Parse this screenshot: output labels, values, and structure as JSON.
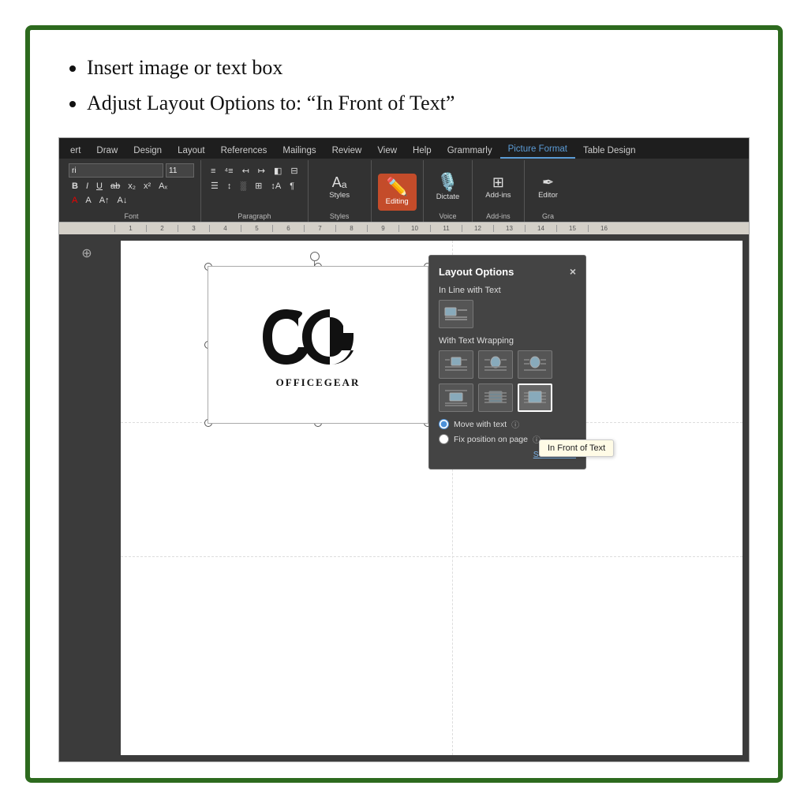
{
  "border_color": "#2d6a1e",
  "instructions": {
    "bullet1": "Insert image or text box",
    "bullet2": "Adjust Layout Options to: “In Front of Text”"
  },
  "ribbon": {
    "tabs": [
      {
        "label": "ert",
        "active": false
      },
      {
        "label": "Draw",
        "active": false
      },
      {
        "label": "Design",
        "active": false
      },
      {
        "label": "Layout",
        "active": false
      },
      {
        "label": "References",
        "active": false
      },
      {
        "label": "Mailings",
        "active": false
      },
      {
        "label": "Review",
        "active": false
      },
      {
        "label": "View",
        "active": false
      },
      {
        "label": "Help",
        "active": false
      },
      {
        "label": "Grammarly",
        "active": false
      },
      {
        "label": "Picture Format",
        "active": true
      },
      {
        "label": "Table Design",
        "active": false
      }
    ],
    "font_name": "ri",
    "font_size": "11",
    "groups": [
      {
        "label": "Font"
      },
      {
        "label": "Paragraph"
      },
      {
        "label": "Styles"
      },
      {
        "label": "Voice"
      },
      {
        "label": "Add-ins"
      },
      {
        "label": "Gra"
      }
    ],
    "buttons": {
      "styles": "Styles",
      "editing": "Editing",
      "dictate": "Dictate",
      "add_ins": "Add-ins",
      "editor": "Editor"
    }
  },
  "logo": {
    "text": "OfficeGear"
  },
  "layout_panel": {
    "title": "Layout Options",
    "close_label": "×",
    "section1": "In Line with Text",
    "section2": "With Text Wrapping",
    "radio1": "Move with text",
    "radio2": "Fix position on page",
    "see_more": "See more...",
    "tooltip": "In Front of Text"
  },
  "ruler_marks": [
    "1",
    "2",
    "3",
    "4",
    "5",
    "6",
    "7",
    "8",
    "9",
    "10",
    "11",
    "12",
    "13",
    "14",
    "15",
    "16"
  ]
}
